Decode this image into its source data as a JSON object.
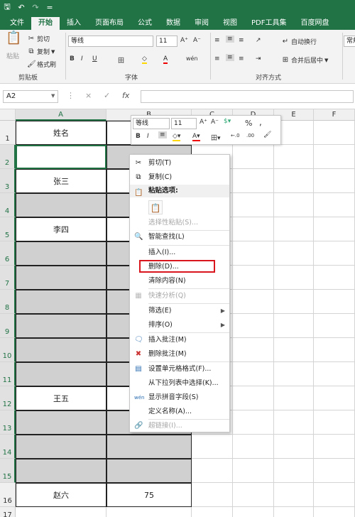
{
  "titlebar": {
    "icons": [
      "save-icon",
      "undo-icon",
      "redo-icon",
      "customize-icon"
    ],
    "glyphs": [
      "🖫",
      "↶",
      "↷",
      "="
    ]
  },
  "menubar": {
    "tabs": [
      "文件",
      "开始",
      "插入",
      "页面布局",
      "公式",
      "数据",
      "审阅",
      "视图",
      "PDF工具集",
      "百度网盘"
    ],
    "active_index": 1
  },
  "ribbon": {
    "clipboard": {
      "paste": "粘贴",
      "cut": "剪切",
      "copy": "复制",
      "format_painter": "格式刷",
      "group": "剪贴板"
    },
    "font": {
      "name": "等线",
      "size": "11",
      "grow": "A⁺",
      "shrink": "A⁻",
      "bold": "B",
      "italic": "I",
      "underline": "U",
      "border": "田",
      "fill": "◇",
      "color": "A",
      "phonetic": "wén",
      "group": "字体"
    },
    "alignment": {
      "wrap": "自动换行",
      "merge": "合并后居中",
      "group": "对齐方式"
    },
    "number": {
      "format": "常规"
    }
  },
  "formulabar": {
    "namebox": "A2",
    "cancel": "×",
    "enter": "✓",
    "fx": "fx",
    "value": ""
  },
  "sheet": {
    "columns": [
      "A",
      "B",
      "C",
      "D",
      "E",
      "F"
    ],
    "rows": [
      {
        "num": "1",
        "a": "姓名",
        "b": ""
      },
      {
        "num": "2",
        "a": "",
        "b": ""
      },
      {
        "num": "3",
        "a": "张三",
        "b": ""
      },
      {
        "num": "4",
        "a": "",
        "b": ""
      },
      {
        "num": "5",
        "a": "李四",
        "b": ""
      },
      {
        "num": "6",
        "a": "",
        "b": ""
      },
      {
        "num": "7",
        "a": "",
        "b": ""
      },
      {
        "num": "8",
        "a": "",
        "b": ""
      },
      {
        "num": "9",
        "a": "",
        "b": ""
      },
      {
        "num": "10",
        "a": "",
        "b": ""
      },
      {
        "num": "11",
        "a": "",
        "b": ""
      },
      {
        "num": "12",
        "a": "王五",
        "b": ""
      },
      {
        "num": "13",
        "a": "",
        "b": ""
      },
      {
        "num": "14",
        "a": "",
        "b": ""
      },
      {
        "num": "15",
        "a": "",
        "b": ""
      },
      {
        "num": "16",
        "a": "赵六",
        "b": "75"
      },
      {
        "num": "17",
        "a": "",
        "b": ""
      }
    ]
  },
  "minitoolbar": {
    "font": "等线",
    "size": "11",
    "percent": "%",
    "comma": ",",
    "inc_decimal": "←.0\n.00",
    "dec_decimal": ".00\n→.0"
  },
  "context_menu": {
    "items": [
      {
        "label": "剪切(T)",
        "icon": "cut-icon",
        "disabled": false
      },
      {
        "label": "复制(C)",
        "icon": "copy-icon",
        "disabled": false
      },
      {
        "label": "粘贴选项:",
        "icon": "paste-icon",
        "disabled": false,
        "header": true
      },
      {
        "label": "选择性粘贴(S)...",
        "icon": "",
        "disabled": true
      },
      {
        "label": "智能查找(L)",
        "icon": "smart-lookup-icon",
        "disabled": false
      },
      {
        "label": "插入(I)...",
        "icon": "",
        "disabled": false
      },
      {
        "label": "删除(D)...",
        "icon": "",
        "disabled": false
      },
      {
        "label": "清除内容(N)",
        "icon": "",
        "disabled": false
      },
      {
        "label": "快速分析(Q)",
        "icon": "quick-analysis-icon",
        "disabled": true
      },
      {
        "label": "筛选(E)",
        "icon": "",
        "disabled": false,
        "submenu": true
      },
      {
        "label": "排序(O)",
        "icon": "",
        "disabled": false,
        "submenu": true
      },
      {
        "label": "插入批注(M)",
        "icon": "insert-comment-icon",
        "disabled": false
      },
      {
        "label": "删除批注(M)",
        "icon": "delete-comment-icon",
        "disabled": false
      },
      {
        "label": "设置单元格格式(F)...",
        "icon": "format-cells-icon",
        "disabled": false
      },
      {
        "label": "从下拉列表中选择(K)...",
        "icon": "",
        "disabled": false
      },
      {
        "label": "显示拼音字段(S)",
        "icon": "phonetic-icon",
        "disabled": false
      },
      {
        "label": "定义名称(A)...",
        "icon": "",
        "disabled": false
      },
      {
        "label": "超链接(I)...",
        "icon": "hyperlink-icon",
        "disabled": true
      }
    ],
    "highlight_color": "#d9161e"
  },
  "colors": {
    "brand": "#217346",
    "gray_cell": "#d0d0d0"
  }
}
